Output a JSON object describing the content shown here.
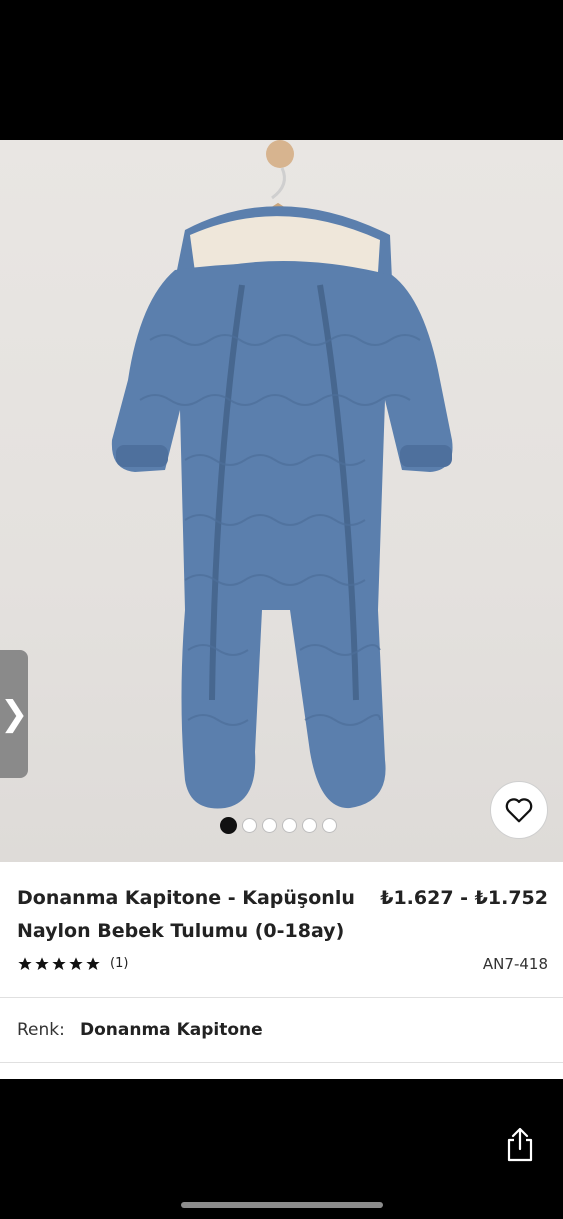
{
  "product": {
    "title": "Donanma Kapitone - Kapüşonlu Naylon Bebek Tulumu (0-18ay)",
    "price": "₺1.627 - ₺1.752",
    "rating_stars": 5,
    "review_count": "(1)",
    "sku": "AN7-418"
  },
  "gallery": {
    "arrow": "❯",
    "image_count": 6,
    "active_index": 0
  },
  "color": {
    "label": "Renk:",
    "value": "Donanma Kapitone"
  },
  "icons": {
    "wishlist": "heart-icon",
    "share": "share-icon",
    "next": "chevron-right-icon"
  },
  "colors": {
    "garment": "#5b7fad",
    "lining": "#efe7da",
    "background": "#e6e3e0"
  }
}
